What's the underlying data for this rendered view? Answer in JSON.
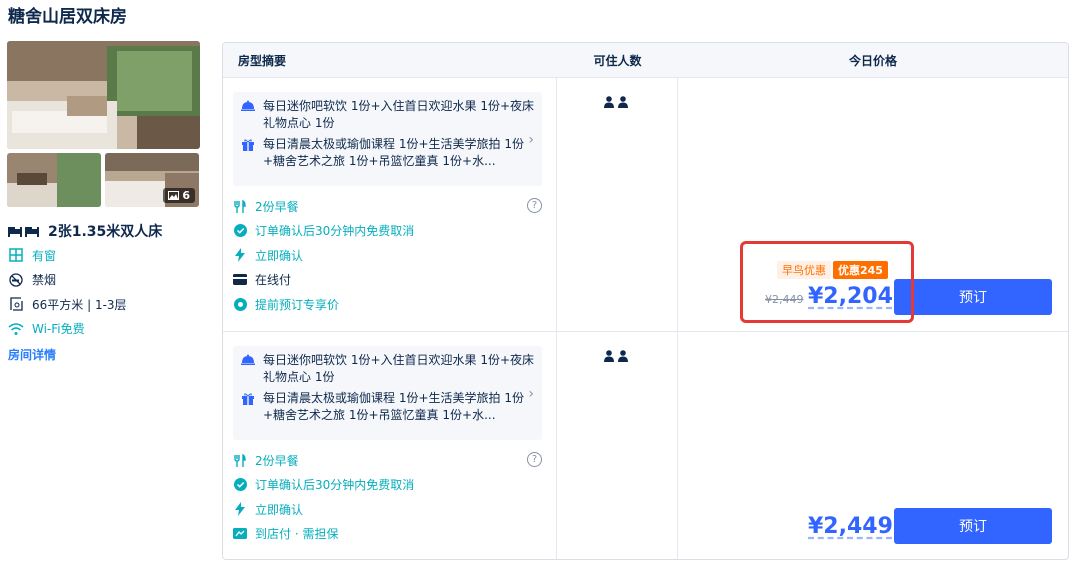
{
  "page_title": "糖舍山居双床房",
  "room": {
    "photo_count": "6",
    "bed": "2张1.35米双人床",
    "facilities": [
      {
        "icon": "window-icon",
        "label": "有窗",
        "color": "#06aebd"
      },
      {
        "icon": "no-smoking-icon",
        "label": "禁烟",
        "color": "#0f294d"
      },
      {
        "icon": "area-icon",
        "label": "66平方米 | 1-3层",
        "color": "#0f294d"
      },
      {
        "icon": "wifi-icon",
        "label": "Wi-Fi免费",
        "color": "#06aebd"
      }
    ],
    "details_link": "房间详情"
  },
  "table": {
    "headers": {
      "summary": "房型摘要",
      "guests": "可住人数",
      "price": "今日价格"
    }
  },
  "rates": [
    {
      "benefits": [
        {
          "icon": "dining-icon",
          "text": "每日迷你吧软饮 1份+入住首日欢迎水果 1份+夜床礼物点心 1份"
        },
        {
          "icon": "gift-icon",
          "text": "每日清晨太极或瑜伽课程 1份+生活美学旅拍 1份+糖舍艺术之旅 1份+吊篮忆童真 1份+水..."
        }
      ],
      "policies": [
        {
          "icon": "breakfast-icon",
          "label": "2份早餐",
          "style": "green"
        },
        {
          "icon": "check-circle-icon",
          "label": "订单确认后30分钟内免费取消",
          "style": "green"
        },
        {
          "icon": "lightning-icon",
          "label": "立即确认",
          "style": "green"
        },
        {
          "icon": "card-icon",
          "label": "在线付",
          "style": "dark"
        },
        {
          "icon": "badge-icon",
          "label": "提前预订专享价",
          "style": "green"
        }
      ],
      "tag_early": "早鸟优惠",
      "tag_discount": "优惠245",
      "price_old": "¥2,449",
      "price_now": "¥2,204",
      "book_label": "预订"
    },
    {
      "benefits": [
        {
          "icon": "dining-icon",
          "text": "每日迷你吧软饮 1份+入住首日欢迎水果 1份+夜床礼物点心 1份"
        },
        {
          "icon": "gift-icon",
          "text": "每日清晨太极或瑜伽课程 1份+生活美学旅拍 1份+糖舍艺术之旅 1份+吊篮忆童真 1份+水..."
        }
      ],
      "policies": [
        {
          "icon": "breakfast-icon",
          "label": "2份早餐",
          "style": "green"
        },
        {
          "icon": "check-circle-icon",
          "label": "订单确认后30分钟内免费取消",
          "style": "green"
        },
        {
          "icon": "lightning-icon",
          "label": "立即确认",
          "style": "green"
        },
        {
          "icon": "hotel-pay-icon",
          "label": "到店付 · 需担保",
          "style": "green"
        }
      ],
      "price_now": "¥2,449",
      "book_label": "预订"
    }
  ],
  "colors": {
    "accent": "#3264ff",
    "green": "#06aebd",
    "orange": "#ff6f00",
    "highlight": "#e53935"
  }
}
